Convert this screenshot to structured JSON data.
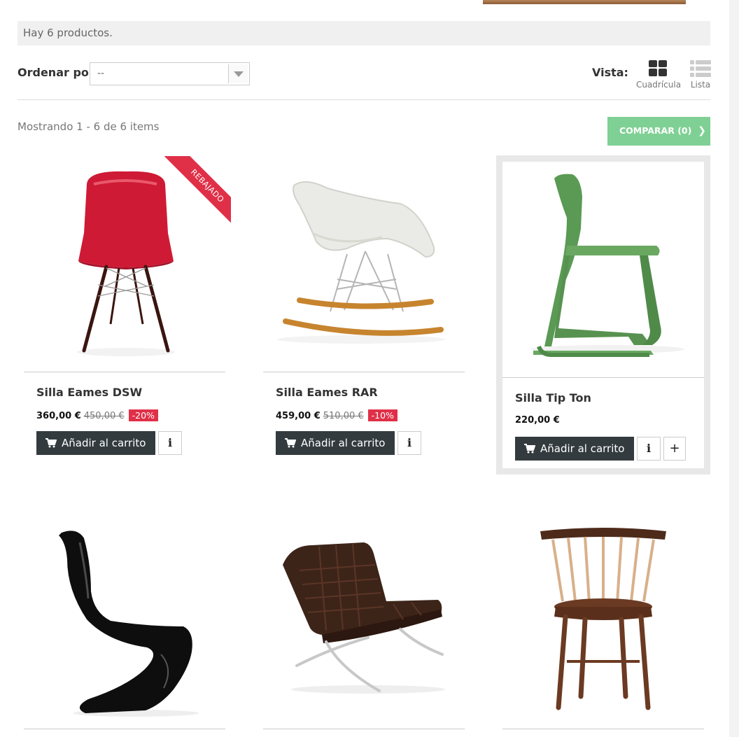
{
  "summary": {
    "count_text": "Hay 6 productos."
  },
  "sort": {
    "label": "Ordenar por",
    "value": "--"
  },
  "view": {
    "label": "Vista:",
    "grid_label": "Cuadrícula",
    "list_label": "Lista"
  },
  "listing": {
    "showing_text": "Mostrando 1 - 6 de 6 items",
    "compare_label": "COMPARAR (0)"
  },
  "products": [
    {
      "name": "Silla Eames DSW",
      "price": "360,00 €",
      "old_price": "450,00 €",
      "discount": "-20%",
      "badge": "REBAJADO",
      "add_to_cart": "Añadir al carrito",
      "image": "red-plastic-side-chair"
    },
    {
      "name": "Silla Eames RAR",
      "price": "459,00 €",
      "old_price": "510,00 €",
      "discount": "-10%",
      "add_to_cart": "Añadir al carrito",
      "image": "white-rocking-chair"
    },
    {
      "name": "Silla Tip Ton",
      "price": "220,00 €",
      "add_to_cart": "Añadir al carrito",
      "image": "green-tilting-chair"
    },
    {
      "image": "black-panton-chair"
    },
    {
      "image": "leather-barcelona-chair"
    },
    {
      "image": "wooden-spindle-chair"
    }
  ],
  "colors": {
    "discount": "#e03048",
    "cart_button": "#333b3f",
    "compare_button": "#7fd094"
  }
}
